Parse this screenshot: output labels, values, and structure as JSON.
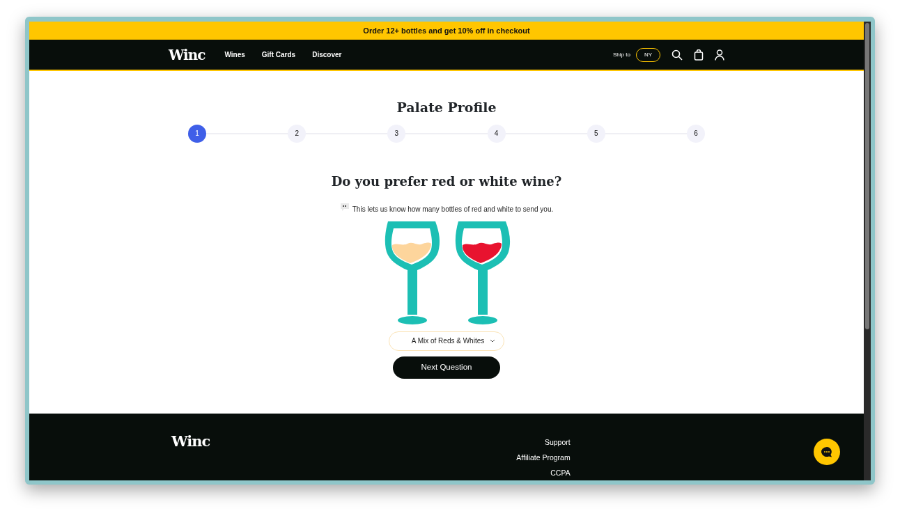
{
  "promo_banner": {
    "text": "Order 12+ bottles and get 10% off in checkout"
  },
  "navbar": {
    "logo": "Winc",
    "links": [
      {
        "label": "Wines"
      },
      {
        "label": "Gift Cards"
      },
      {
        "label": "Discover"
      }
    ],
    "ship_to_label": "Ship to",
    "ship_to_state": "NY"
  },
  "quiz": {
    "title": "Palate Profile",
    "steps": [
      {
        "label": "1",
        "selected": true
      },
      {
        "label": "2",
        "selected": false
      },
      {
        "label": "3",
        "selected": false
      },
      {
        "label": "4",
        "selected": false
      },
      {
        "label": "5",
        "selected": false
      },
      {
        "label": "6",
        "selected": false
      }
    ],
    "question": "Do you prefer red or white wine?",
    "hint": "This lets us know how many bottles of red and white to send you.",
    "answer_select": {
      "value": "A Mix of Reds & Whites"
    },
    "next_button": "Next Question"
  },
  "footer": {
    "logo": "Winc",
    "links": [
      {
        "label": "Support"
      },
      {
        "label": "Affiliate Program"
      },
      {
        "label": "CCPA"
      }
    ]
  }
}
